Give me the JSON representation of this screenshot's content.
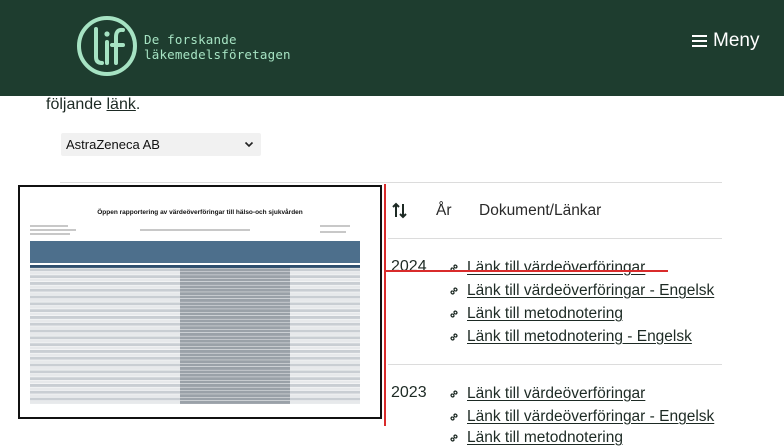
{
  "header": {
    "logo_mark": "lif",
    "logo_line1": "De forskande",
    "logo_line2": "läkemedelsföretagen",
    "menu_label": "Meny",
    "menu_icon": "hamburger-icon",
    "colors": {
      "background": "#1e3d2f",
      "logo": "#a6e3c3"
    }
  },
  "intro": {
    "text": "följande ",
    "link": "länk",
    "suffix": "."
  },
  "company_select": {
    "value": "AstraZeneca AB"
  },
  "table": {
    "columns": {
      "year": "År",
      "documents": "Dokument/Länkar"
    },
    "sort_icon": "sort-arrows-icon",
    "link_icon": "chain-link-icon",
    "rows": [
      {
        "year": "2024",
        "links": [
          "Länk till värdeöverföringar",
          "Länk till värdeöverföringar - Engelsk",
          "Länk till metodnotering",
          "Länk till metodnotering - Engelsk"
        ]
      },
      {
        "year": "2023",
        "links": [
          "Länk till värdeöverföringar",
          "Länk till värdeöverföringar - Engelsk",
          "Länk till metodnotering"
        ]
      }
    ]
  },
  "preview": {
    "title": "Öppen rapportering av värdeöverföringar till hälso-och sjukvården"
  },
  "annotation_color": "#d92b2b"
}
